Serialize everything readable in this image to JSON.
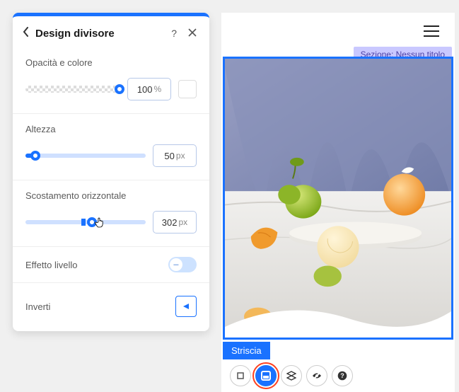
{
  "panel": {
    "title": "Design divisore",
    "opacity": {
      "label": "Opacità e colore",
      "value": "100",
      "unit": "%",
      "percent": 100
    },
    "height": {
      "label": "Altezza",
      "value": "50",
      "unit": "px",
      "percent": 8
    },
    "offset": {
      "label": "Scostamento orizzontale",
      "value": "302",
      "unit": "px",
      "percent": 52
    },
    "layerEffect": {
      "label": "Effetto livello",
      "enabled": false
    },
    "invert": {
      "label": "Inverti"
    }
  },
  "preview": {
    "sectionLabel": "Sezione: Nessun titolo",
    "stripLabel": "Striscia"
  },
  "colors": {
    "primary": "#1a72ff",
    "sectionPill": "#c9c8ff",
    "activeOutline": "#ff4020"
  }
}
